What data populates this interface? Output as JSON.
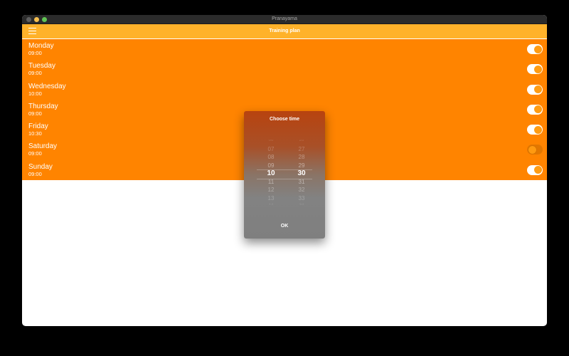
{
  "window": {
    "title": "Pranayama"
  },
  "appbar": {
    "title": "Training plan",
    "menu_icon": "hamburger-menu-icon"
  },
  "schedule": [
    {
      "day": "Monday",
      "time": "09:00",
      "enabled": true
    },
    {
      "day": "Tuesday",
      "time": "09:00",
      "enabled": true
    },
    {
      "day": "Wednesday",
      "time": "10:00",
      "enabled": true
    },
    {
      "day": "Thursday",
      "time": "09:00",
      "enabled": true
    },
    {
      "day": "Friday",
      "time": "10:30",
      "enabled": true
    },
    {
      "day": "Saturday",
      "time": "09:00",
      "enabled": false
    },
    {
      "day": "Sunday",
      "time": "09:00",
      "enabled": true
    }
  ],
  "dialog": {
    "title": "Choose time",
    "ok_label": "OK",
    "hours": [
      "06",
      "07",
      "08",
      "09",
      "10",
      "11",
      "12",
      "13",
      "14"
    ],
    "minutes": [
      "26",
      "27",
      "28",
      "29",
      "30",
      "31",
      "32",
      "33",
      "34"
    ],
    "selected_hour": "10",
    "selected_minute": "30"
  },
  "colors": {
    "list_background": "#ff8400",
    "appbar_background": "#ffb22a",
    "toggle_knob": "#ff9c13"
  }
}
